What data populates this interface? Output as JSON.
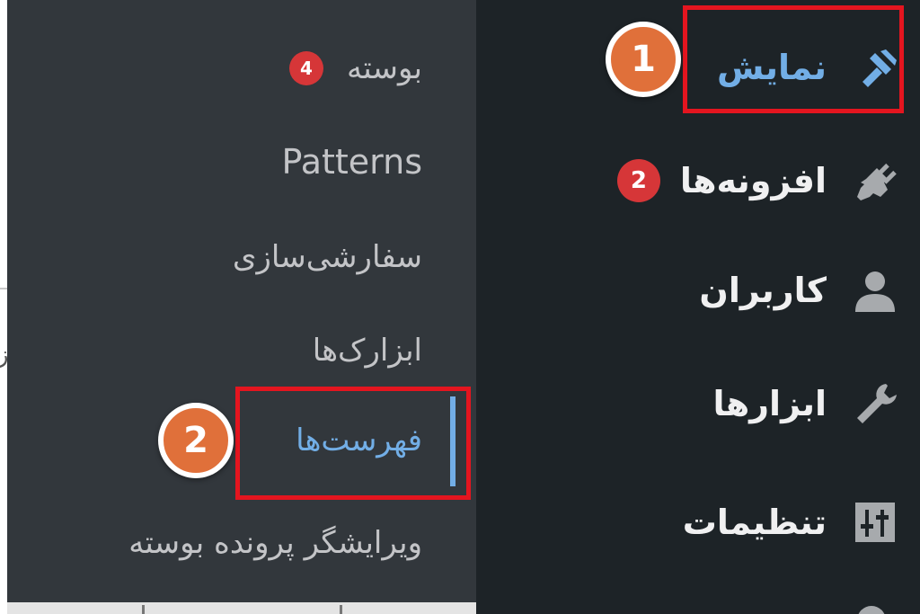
{
  "submenu": {
    "items": [
      {
        "label": "بوسته",
        "count": "4"
      },
      {
        "label": "Patterns"
      },
      {
        "label": "سفارشی‌سازی"
      },
      {
        "label": "ابزارک‌ها"
      },
      {
        "label": "فهرست‌ها",
        "active": true
      },
      {
        "label": "ویرایشگر پرونده بوسته"
      }
    ]
  },
  "sidebar": {
    "items": [
      {
        "label": "نمایش",
        "icon": "paintbrush-icon",
        "active": true
      },
      {
        "label": "افزونه‌ها",
        "icon": "plugin-icon",
        "count": "2"
      },
      {
        "label": "کاربران",
        "icon": "user-icon"
      },
      {
        "label": "ابزارها",
        "icon": "wrench-icon"
      },
      {
        "label": "تنظیمات",
        "icon": "settings-sliders-icon"
      }
    ]
  },
  "annotations": {
    "step1": "1",
    "step2": "2"
  },
  "colors": {
    "sidebar_bg": "#1d2327",
    "submenu_bg": "#32373c",
    "active_text": "#72aee6",
    "badge_red": "#d63638",
    "highlight_red": "#e4151f",
    "step_orange": "#e0703a"
  }
}
